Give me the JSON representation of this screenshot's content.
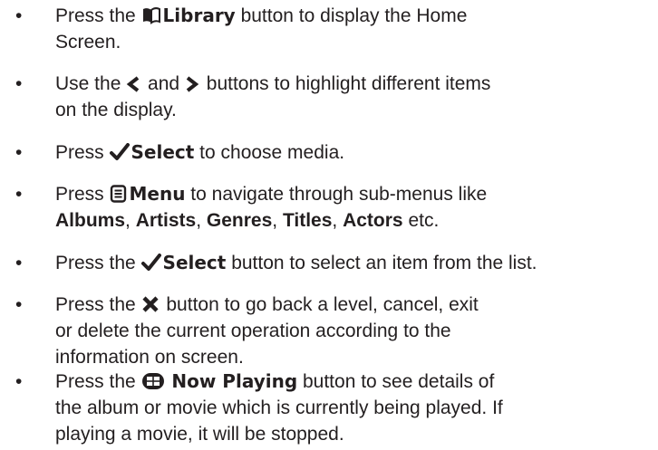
{
  "items": [
    {
      "bullet": "•",
      "t1": "Press the ",
      "icon": "book-icon",
      "k1": "Library",
      "t2": " button to display the Home",
      "line2": "Screen."
    },
    {
      "bullet": "•",
      "t1": "Use the ",
      "icon_left": "chevron-left-icon",
      "t2": " and ",
      "icon_right": "chevron-right-icon",
      "t3": " buttons to highlight different items",
      "line2": "on the display."
    },
    {
      "bullet": "•",
      "t1": "Press ",
      "icon": "checkmark-icon",
      "k1": "Select",
      "t2": " to choose media."
    },
    {
      "bullet": "•",
      "t1": "Press ",
      "icon": "menu-icon",
      "k1": "Menu",
      "t2": " to navigate through sub-menus like",
      "b1": "Albums",
      "s1": ", ",
      "b2": "Artists",
      "s2": ", ",
      "b3": "Genres",
      "s3": ", ",
      "b4": "Titles",
      "s4": ", ",
      "b5": "Actors",
      "s5": " etc."
    },
    {
      "bullet": "•",
      "t1": "Press the ",
      "icon": "checkmark-icon",
      "k1": "Select",
      "t2": " button to select an item from the list."
    },
    {
      "bullet": "•",
      "t1": "Press the ",
      "icon": "close-icon",
      "t2": " button to go back a level, cancel, exit",
      "line2": "or delete the current operation according to the",
      "line3": "information on screen."
    },
    {
      "bullet": "•",
      "t1": "Press the ",
      "icon": "now-playing-icon",
      "k1": "Now Playing",
      "t2": " button to see details of",
      "line2": "the album or movie which is currently being played. If",
      "line3": "playing a movie, it will be stopped."
    }
  ]
}
